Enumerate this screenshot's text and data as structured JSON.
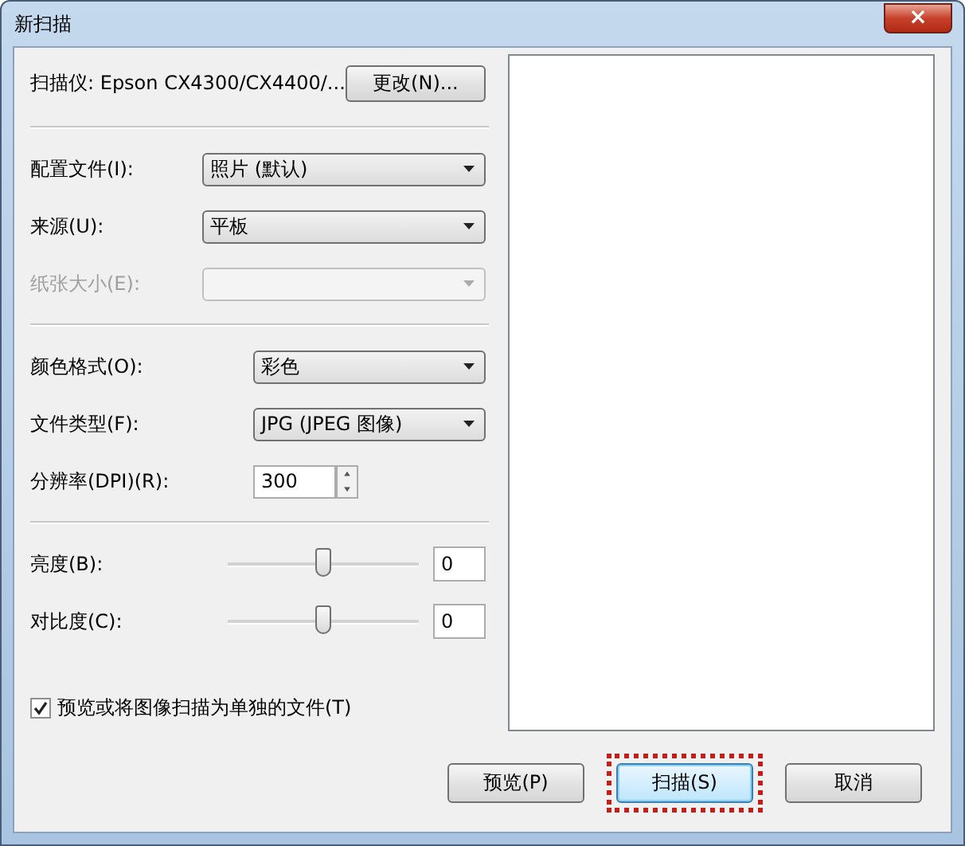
{
  "window": {
    "title": "新扫描",
    "close": "×"
  },
  "scanner": {
    "label": "扫描仪: Epson CX4300/CX4400/...",
    "button": "更改(N)..."
  },
  "groups": [
    {
      "rows": [
        {
          "kind": "dropdown",
          "label": "配置文件(I):",
          "value": "照片 (默认)",
          "disabled": false
        },
        {
          "kind": "dropdown",
          "label": "来源(U):",
          "value": "平板",
          "disabled": false
        },
        {
          "kind": "dropdown",
          "label": "纸张大小(E):",
          "disabled": true
        }
      ]
    },
    {
      "rows": [
        {
          "kind": "dropdown",
          "label": "颜色格式(O):",
          "value": "彩色",
          "disabled": false
        },
        {
          "kind": "dropdown",
          "label": "文件类型(F):",
          "value": "JPG (JPEG 图像)",
          "disabled": false
        },
        {
          "kind": "spin",
          "label": "分辨率(DPI)(R):",
          "value": "300"
        }
      ]
    },
    {
      "rows": [
        {
          "kind": "slider",
          "label": "亮度(B):",
          "level": 0.5,
          "value": "0"
        },
        {
          "kind": "slider",
          "label": "对比度(C):",
          "level": 0.5,
          "value": "0"
        }
      ]
    }
  ],
  "checkbox": {
    "label": "预览或将图像扫描为单独的文件(T)",
    "checked": true
  },
  "buttons": [
    {
      "label": "预览(P)",
      "highlighted": false
    },
    {
      "label": "扫描(S)",
      "highlighted": true
    },
    {
      "label": "取消",
      "highlighted": false
    }
  ]
}
